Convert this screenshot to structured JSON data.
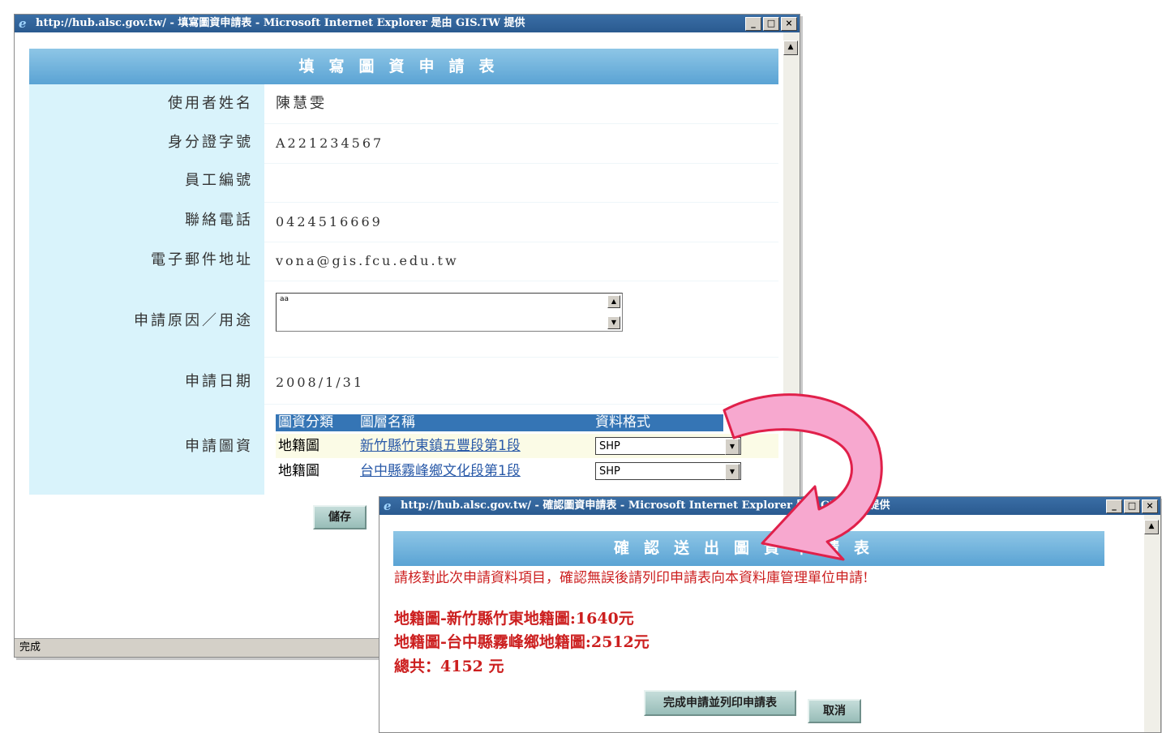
{
  "main_window": {
    "title": "http://hub.alsc.gov.tw/ - 填寫圖資申請表 - Microsoft Internet Explorer 是由 GIS.TW 提供",
    "header": "填寫圖資申請表",
    "fields": [
      {
        "label": "使用者姓名",
        "value": "陳慧雯"
      },
      {
        "label": "身分證字號",
        "value": "A221234567"
      },
      {
        "label": "員工編號",
        "value": ""
      },
      {
        "label": "聯絡電話",
        "value": "0424516669"
      },
      {
        "label": "電子郵件地址",
        "value": "vona@gis.fcu.edu.tw"
      }
    ],
    "reason_label": "申請原因／用途",
    "reason_value": "aa",
    "date_label": "申請日期",
    "date_value": "2008/1/31",
    "data_label": "申請圖資",
    "table": {
      "headers": [
        "圖資分類",
        "圖層名稱",
        "資料格式"
      ],
      "rows": [
        {
          "category": "地籍圖",
          "layer": "新竹縣竹東鎮五豐段第1段",
          "format": "SHP"
        },
        {
          "category": "地籍圖",
          "layer": "台中縣霧峰鄉文化段第1段",
          "format": "SHP"
        }
      ]
    },
    "save_button": "儲存",
    "status_text": "完成"
  },
  "confirm_window": {
    "title": "http://hub.alsc.gov.tw/ - 確認圖資申請表 - Microsoft Internet Explorer 是由 GIS.TW 提供",
    "header": "確認送出圖資申請表",
    "notice": "請核對此次申請資料項目，確認無誤後請列印申請表向本資料庫管理單位申請!",
    "items": [
      "地籍圖-新竹縣竹東地籍圖:1640元",
      "地籍圖-台中縣霧峰鄉地籍圖:2512元"
    ],
    "total": "總共：4152 元",
    "submit_button": "完成申請並列印申請表",
    "cancel_button": "取消"
  },
  "colors": {
    "arrow_fill": "#f7a8cf",
    "arrow_stroke": "#e0204a",
    "header_blue": "#5aa3d4",
    "label_bg": "#d9f3fb",
    "red_text": "#cc1f1f"
  }
}
